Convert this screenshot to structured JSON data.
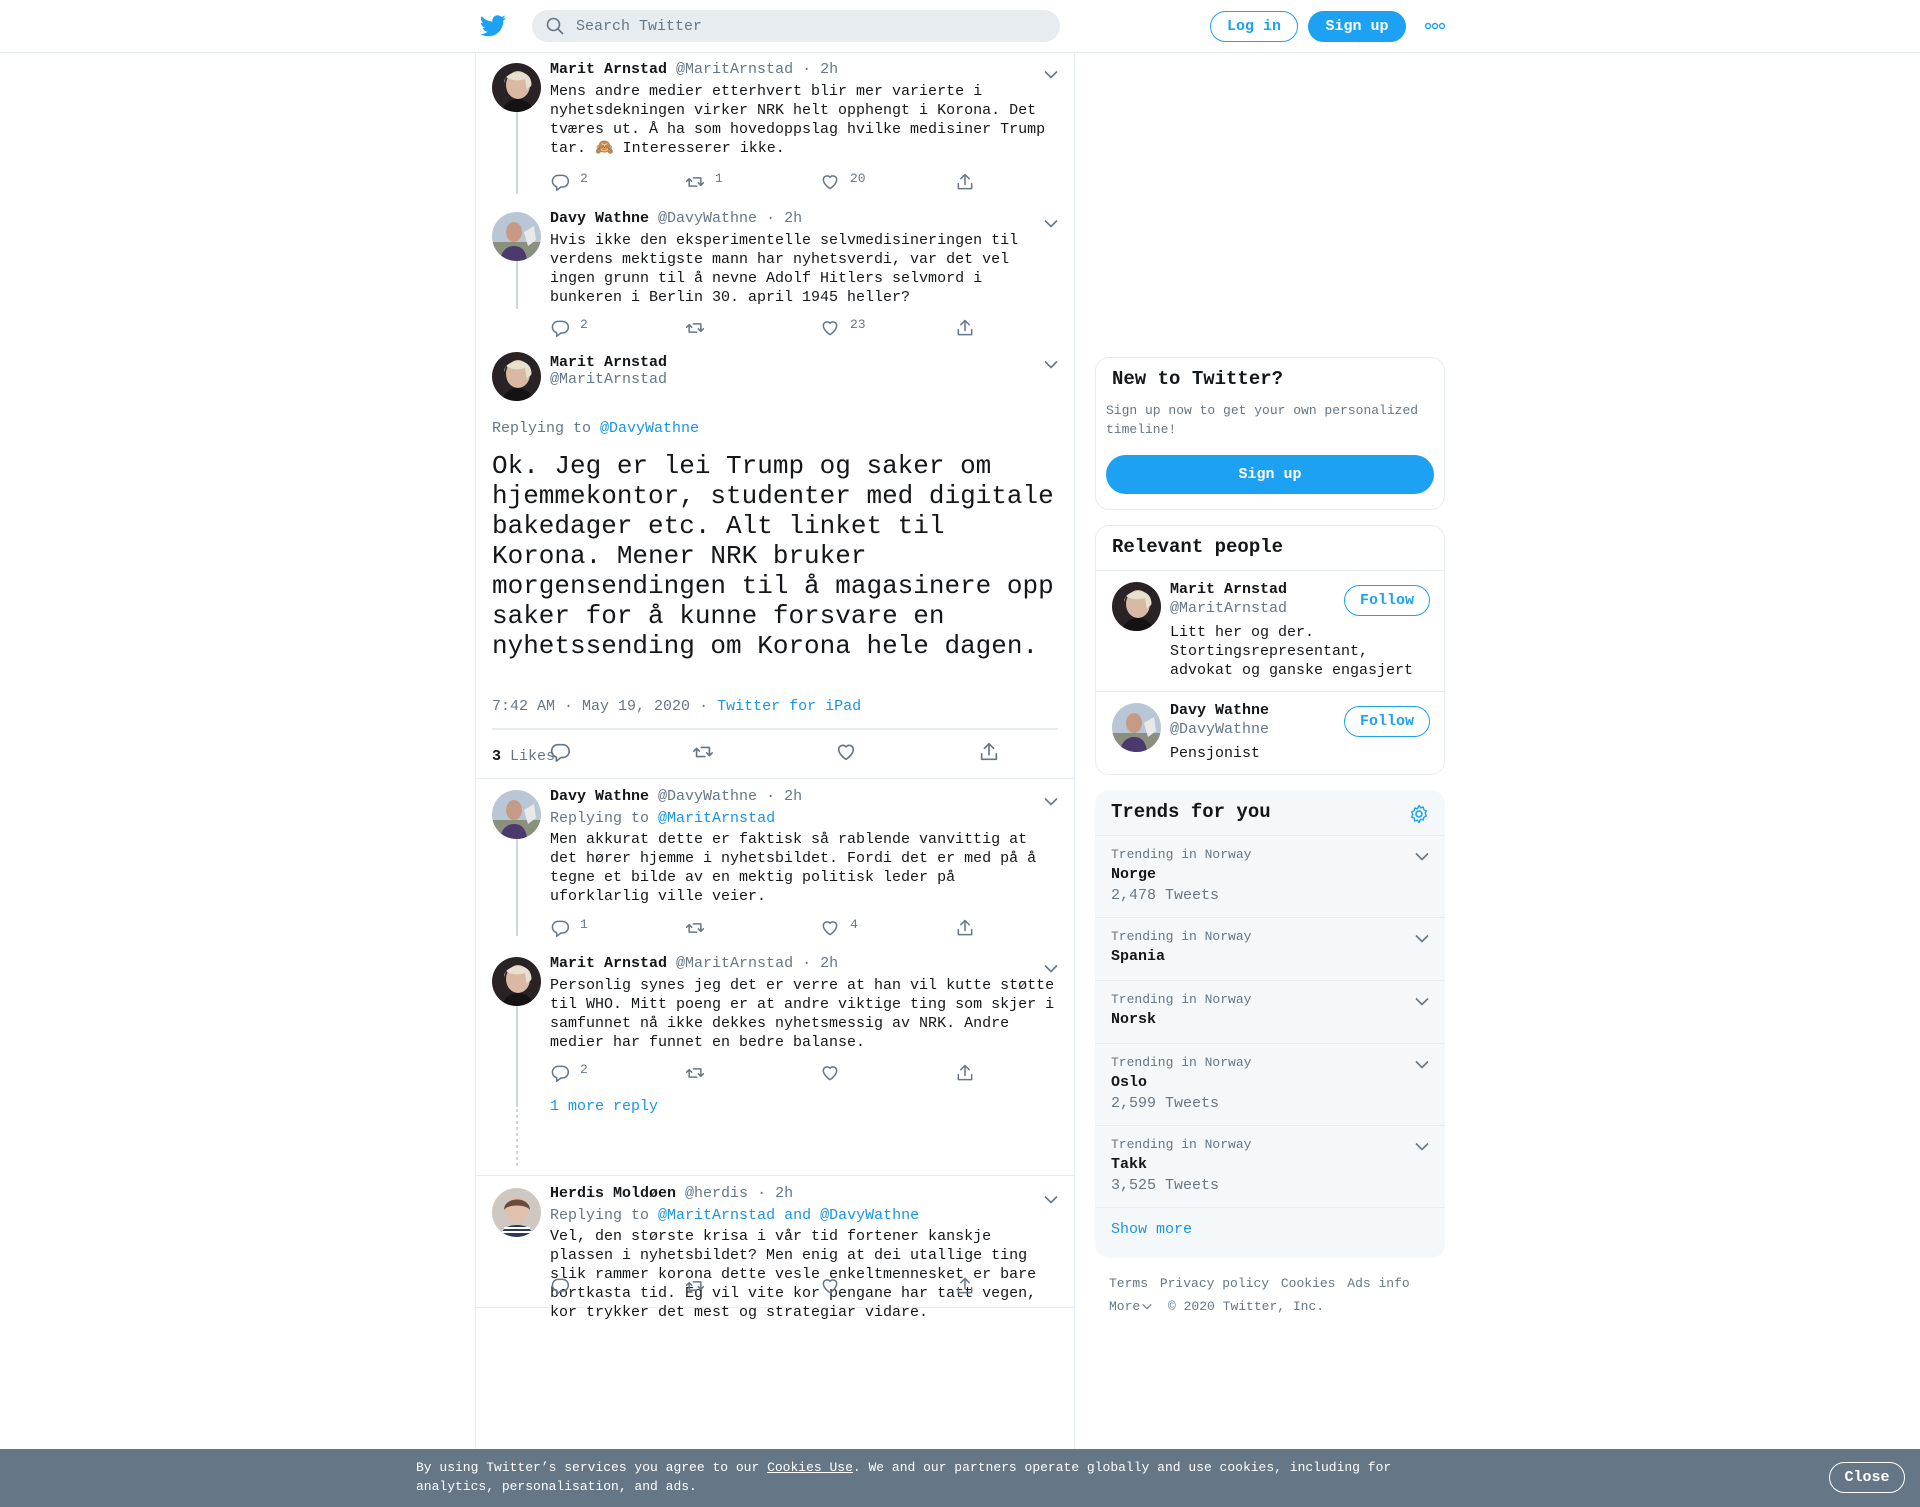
{
  "header": {
    "search_placeholder": "Search Twitter",
    "login_label": "Log in",
    "signup_label": "Sign up"
  },
  "colors": {
    "accent": "#1da1f2",
    "link": "#1b95e0",
    "muted": "#657786"
  },
  "tweets": [
    {
      "name": "Marit Arnstad",
      "handle": "@MaritArnstad",
      "time": "· 2h",
      "text": "Mens andre medier etterhvert blir mer varierte i nyhetsdekningen virker NRK helt opphengt i Korona. Det tværes ut. Å ha som hovedoppslag hvilke medisiner Trump tar. 🙈 Interesserer ikke.",
      "replies": "2",
      "retweets": "1",
      "likes": "20"
    },
    {
      "name": "Davy Wathne",
      "handle": "@DavyWathne",
      "time": "· 2h",
      "text": "Hvis ikke den eksperimentelle selvmedisineringen til verdens mektigste mann har nyhetsverdi, var det vel ingen grunn til å nevne Adolf Hitlers selvmord i bunkeren i Berlin 30. april 1945 heller?",
      "replies": "2",
      "retweets": "",
      "likes": "23"
    }
  ],
  "focus": {
    "name": "Marit Arnstad",
    "handle": "@MaritArnstad",
    "replying_prefix": "Replying to",
    "replying_to": "@DavyWathne",
    "text": "Ok. Jeg er lei Trump og saker om hjemmekontor, studenter med digitale bakedager etc. Alt linket til Korona. Mener NRK bruker morgensendingen til å magasinere opp saker for å kunne forsvare en nyhetssending om Korona hele dagen.",
    "timestamp": "7:42 AM · May 19, 2020",
    "dot": "·",
    "source": "Twitter for iPad",
    "likes_count": "3",
    "likes_label": "Likes"
  },
  "replies": [
    {
      "name": "Davy Wathne",
      "handle": "@DavyWathne",
      "time": "· 2h",
      "replying_prefix": "Replying to",
      "replying_to": "@MaritArnstad",
      "text": "Men akkurat dette er faktisk så rablende vanvittig at det hører hjemme i nyhetsbildet. Fordi det er med på å tegne et bilde av en mektig politisk leder på uforklarlig ville veier.",
      "replies": "1",
      "retweets": "",
      "likes": "4"
    },
    {
      "name": "Marit Arnstad",
      "handle": "@MaritArnstad",
      "time": "· 2h",
      "text": "Personlig synes jeg det er verre at han vil kutte støtte til WHO. Mitt poeng er at andre viktige ting som skjer i samfunnet nå ikke dekkes nyhetsmessig av NRK. Andre medier har funnet en bedre balanse.",
      "replies": "2",
      "retweets": "",
      "likes": "",
      "more_reply": "1 more reply"
    },
    {
      "name": "Herdis Moldøen",
      "handle": "@herdis",
      "time": "· 2h",
      "replying_prefix": "Replying to",
      "replying_to": "@MaritArnstad and @DavyWathne",
      "text": "Vel, den største krisa i vår tid fortener kanskje plassen i nyhetsbildet? Men enig at dei utallige ting slik rammer korona dette vesle enkeltmennesket er bare bortkasta tid. Eg vil vite kor pengane har tatt vegen, kor trykker det mest og strategiar vidare.",
      "replies": "",
      "retweets": "",
      "likes": ""
    }
  ],
  "sidebar": {
    "new_title": "New to Twitter?",
    "new_text": "Sign up now to get your own personalized timeline!",
    "new_button": "Sign up",
    "people_title": "Relevant people",
    "people": [
      {
        "name": "Marit Arnstad",
        "handle": "@MaritArnstad",
        "bio": "Litt her og der. Stortingsrepresentant, advokat og ganske engasjert",
        "follow": "Follow"
      },
      {
        "name": "Davy Wathne",
        "handle": "@DavyWathne",
        "bio": "Pensjonist",
        "follow": "Follow"
      }
    ],
    "trends_title": "Trends for you",
    "trends": [
      {
        "label": "Trending in Norway",
        "name": "Norge",
        "count": "2,478 Tweets"
      },
      {
        "label": "Trending in Norway",
        "name": "Spania",
        "count": ""
      },
      {
        "label": "Trending in Norway",
        "name": "Norsk",
        "count": ""
      },
      {
        "label": "Trending in Norway",
        "name": "Oslo",
        "count": "2,599 Tweets"
      },
      {
        "label": "Trending in Norway",
        "name": "Takk",
        "count": "3,525 Tweets"
      }
    ],
    "show_more": "Show more"
  },
  "footer": {
    "links": [
      "Terms",
      "Privacy policy",
      "Cookies",
      "Ads info"
    ],
    "more": "More",
    "copyright": "© 2020 Twitter, Inc."
  },
  "cookie": {
    "pre": "By using Twitter’s services you agree to our ",
    "link": "Cookies Use",
    "post": ". We and our partners operate globally and use cookies, including for analytics, personalisation, and ads.",
    "close": "Close"
  }
}
